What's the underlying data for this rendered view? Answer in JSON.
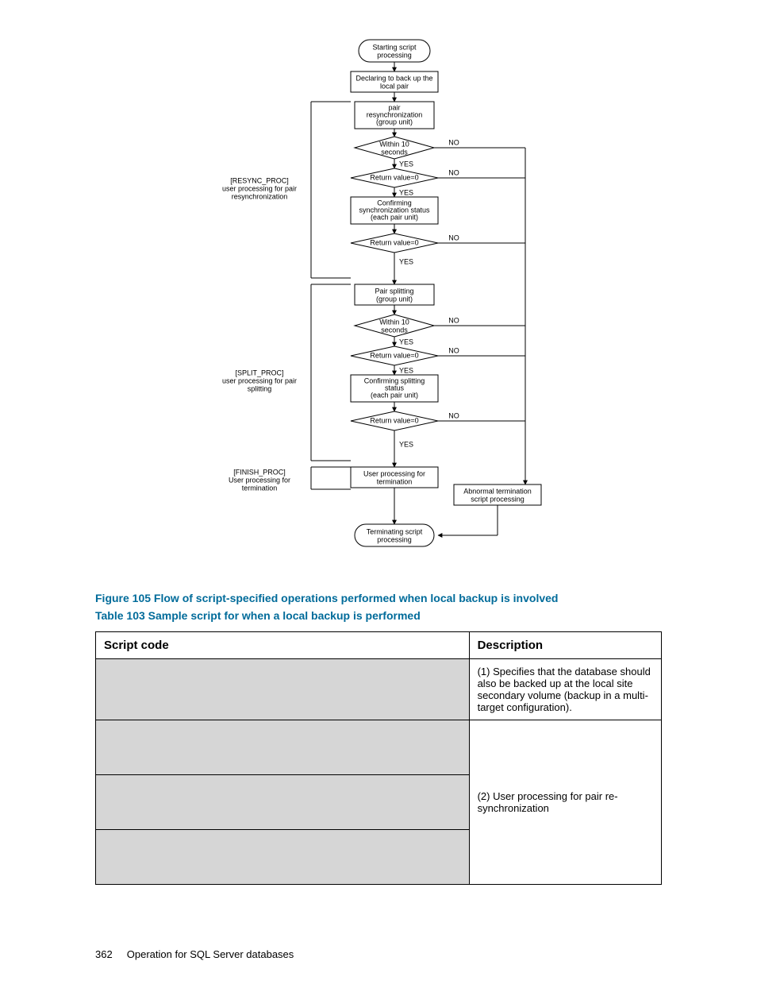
{
  "flowchart": {
    "side_labels": {
      "resync": {
        "tag": "[RESYNC_PROC]",
        "l1": "user processing for pair",
        "l2": "resynchronization"
      },
      "split": {
        "tag": "[SPLIT_PROC]",
        "l1": "user processing for pair",
        "l2": "splitting"
      },
      "finish": {
        "tag": "[FINISH_PROC]",
        "l1": "User processing for",
        "l2": "termination"
      }
    },
    "nodes": {
      "start": {
        "l1": "Starting script",
        "l2": "processing"
      },
      "declare": {
        "l1": "Declaring to back up the",
        "l2": "local pair"
      },
      "pair_resync": {
        "l1": "pair",
        "l2": "resynchronization",
        "l3": "(group unit)"
      },
      "within10a": {
        "l1": "Within 10",
        "l2": "seconds"
      },
      "rv0a": "Return value=0",
      "confirm_sync": {
        "l1": "Confirming",
        "l2": "synchronization status",
        "l3": "(each pair unit)"
      },
      "rv0b": "Return value=0",
      "pair_split": {
        "l1": "Pair splitting",
        "l2": "(group unit)"
      },
      "within10b": {
        "l1": "Within 10",
        "l2": "seconds"
      },
      "rv0c": "Return value=0",
      "confirm_split": {
        "l1": "Confirming splitting",
        "l2": "status",
        "l3": "(each pair unit)"
      },
      "rv0d": "Return value=0",
      "user_term": {
        "l1": "User processing for",
        "l2": "termination"
      },
      "abnormal": {
        "l1": "Abnormal termination",
        "l2": "script processing"
      },
      "terminate": {
        "l1": "Terminating script",
        "l2": "processing"
      }
    },
    "labels": {
      "YES": "YES",
      "NO": "NO"
    }
  },
  "figure_caption": "Figure 105 Flow of script-specified operations performed when local backup is involved",
  "table_caption": "Table 103 Sample script for when a local backup is performed",
  "table": {
    "headers": {
      "code": "Script code",
      "desc": "Description"
    },
    "rows": [
      {
        "code": "",
        "desc": "(1) Specifies that the database should also be backed up at the local site secondary volume (backup in a multi-target config­uration)."
      },
      {
        "code": "",
        "desc_merge_start": true,
        "desc": "(2) User processing for pair re­synchronization"
      },
      {
        "code": ""
      },
      {
        "code": ""
      }
    ]
  },
  "footer": {
    "page": "362",
    "title": "Operation for SQL Server databases"
  }
}
